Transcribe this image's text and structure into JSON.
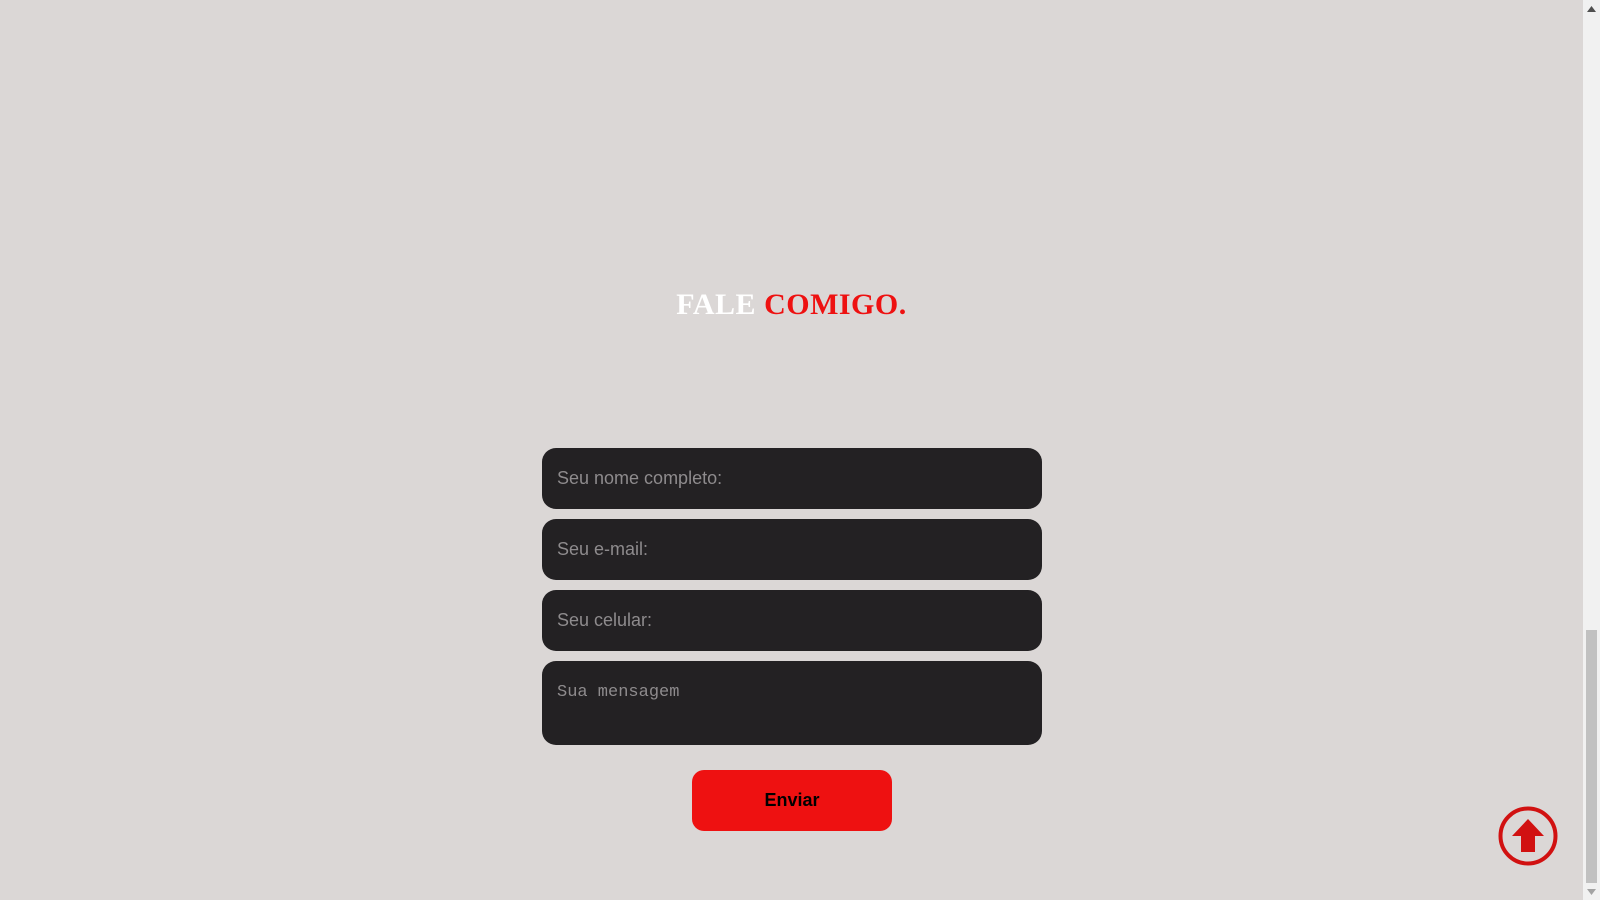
{
  "heading": {
    "part1": "FALE",
    "part2": "COMIGO."
  },
  "form": {
    "name_placeholder": "Seu nome completo:",
    "email_placeholder": "Seu e-mail:",
    "phone_placeholder": "Seu celular:",
    "message_placeholder": "Sua mensagem",
    "submit_label": "Enviar"
  },
  "colors": {
    "background": "#dbd7d6",
    "field_bg": "#232123",
    "accent": "#ee1111",
    "heading_white": "#ffffff"
  },
  "icons": {
    "back_to_top": "arrow-up-circle-icon"
  },
  "scrollbar": {
    "position_fraction": 0.93
  }
}
